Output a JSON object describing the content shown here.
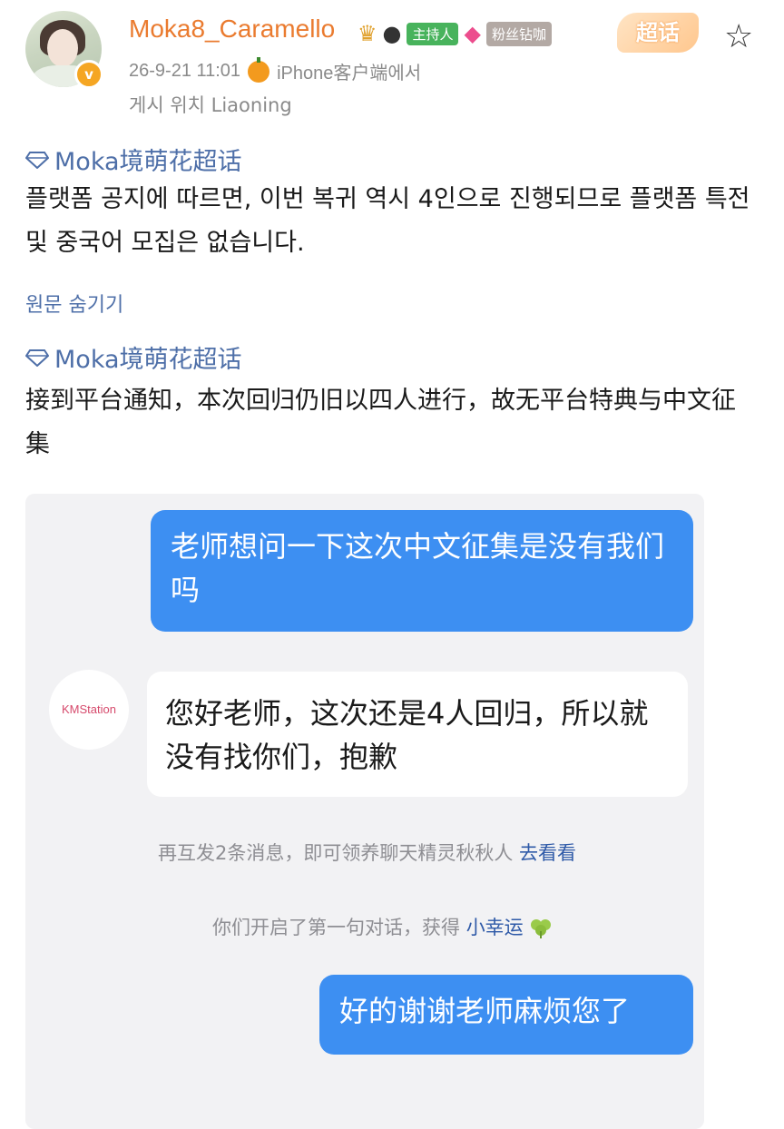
{
  "post": {
    "username": "Moka8_Caramello",
    "badges": {
      "crown_icon": "crown-icon",
      "panda_icon": "panda-icon",
      "host_label": "主持人",
      "level_icon": "diamond-level-icon",
      "fans_label": "粉丝钻咖",
      "supertopic_label": "超话"
    },
    "timestamp": "26-9-21 11:01",
    "client": "iPhone客户端에서",
    "location": "게시 위치 Liaoning"
  },
  "content": {
    "topic_label": "Moka境萌花超话",
    "translated_text": "플랫폼 공지에 따르면, 이번 복귀 역시 4인으로 진행되므로 플랫폼 특전 및 중국어 모집은 없습니다.",
    "toggle_label": "원문 숨기기",
    "original_topic_label": "Moka境萌花超话",
    "original_text": "接到平台通知，本次回归仍旧以四人进行，故无平台特典与中文征集"
  },
  "chat": {
    "message_1": "老师想问一下这次中文征集是没有我们吗",
    "sender_avatar_text": "KMStation",
    "message_2": "您好老师，这次还是4人回归，所以就没有找你们，抱歉",
    "system_note_1": "再互发2条消息，即可领养聊天精灵秋秋人",
    "system_note_1_link": "去看看",
    "system_note_2": "你们开启了第一句对话，获得",
    "system_note_2_link": "小幸运",
    "message_3": "好的谢谢老师麻烦您了"
  }
}
